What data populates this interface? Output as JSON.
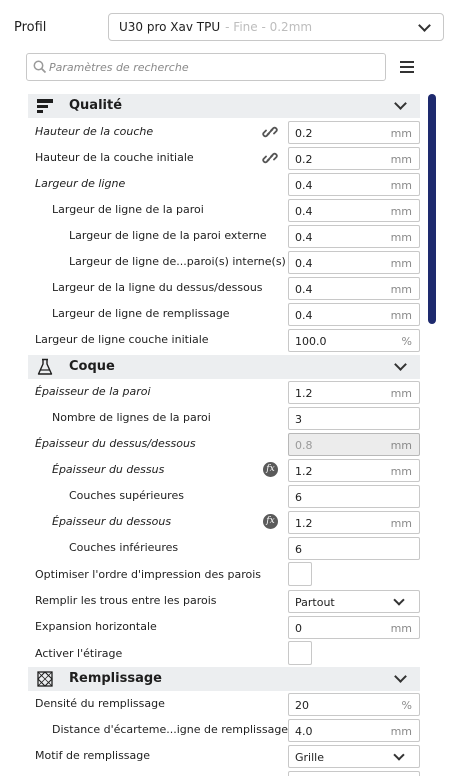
{
  "profile": {
    "label": "Profil",
    "selected": "U30 pro Xav TPU",
    "selected_sub": "- Fine - 0.2mm"
  },
  "search": {
    "placeholder": "Paramètres de recherche"
  },
  "icons": {
    "search": "search-icon",
    "menu": "hamburger-menu-icon",
    "link": "link-icon",
    "fx": "function-icon"
  },
  "colors": {
    "accent": "#1e2a6e",
    "category_bg": "#eceef0"
  },
  "categories": {
    "quality": {
      "title": "Qualité"
    },
    "shell": {
      "title": "Coque"
    },
    "infill": {
      "title": "Remplissage"
    }
  },
  "settings": {
    "layer_height": {
      "label": "Hauteur de la couche",
      "value": "0.2",
      "unit": "mm"
    },
    "initial_layer_height": {
      "label": "Hauteur de la couche initiale",
      "value": "0.2",
      "unit": "mm"
    },
    "line_width": {
      "label": "Largeur de ligne",
      "value": "0.4",
      "unit": "mm"
    },
    "wall_line_width": {
      "label": "Largeur de ligne de la paroi",
      "value": "0.4",
      "unit": "mm"
    },
    "outer_wall_line_width": {
      "label": "Largeur de ligne de la paroi externe",
      "value": "0.4",
      "unit": "mm"
    },
    "inner_wall_line_width": {
      "label": "Largeur de ligne de...paroi(s) interne(s)",
      "value": "0.4",
      "unit": "mm"
    },
    "top_bottom_line_width": {
      "label": "Largeur de la ligne du dessus/dessous",
      "value": "0.4",
      "unit": "mm"
    },
    "infill_line_width": {
      "label": "Largeur de ligne de remplissage",
      "value": "0.4",
      "unit": "mm"
    },
    "initial_layer_line_width": {
      "label": "Largeur de ligne couche initiale",
      "value": "100.0",
      "unit": "%"
    },
    "wall_thickness": {
      "label": "Épaisseur de la paroi",
      "value": "1.2",
      "unit": "mm"
    },
    "wall_line_count": {
      "label": "Nombre de lignes de la paroi",
      "value": "3"
    },
    "top_bottom_thickness": {
      "label": "Épaisseur du dessus/dessous",
      "value": "0.8",
      "unit": "mm"
    },
    "top_thickness": {
      "label": "Épaisseur du dessus",
      "value": "1.2",
      "unit": "mm"
    },
    "top_layers": {
      "label": "Couches supérieures",
      "value": "6"
    },
    "bottom_thickness": {
      "label": "Épaisseur du dessous",
      "value": "1.2",
      "unit": "mm"
    },
    "bottom_layers": {
      "label": "Couches inférieures",
      "value": "6"
    },
    "optimize_wall_order": {
      "label": "Optimiser l'ordre d'impression des parois",
      "checked": false
    },
    "fill_gaps": {
      "label": "Remplir les trous entre les parois",
      "value": "Partout"
    },
    "horizontal_expansion": {
      "label": "Expansion horizontale",
      "value": "0",
      "unit": "mm"
    },
    "enable_ironing": {
      "label": "Activer l'étirage",
      "checked": false
    },
    "infill_density": {
      "label": "Densité du remplissage",
      "value": "20",
      "unit": "%"
    },
    "infill_line_distance": {
      "label": "Distance d'écarteme...igne de remplissage",
      "value": "4.0",
      "unit": "mm"
    },
    "infill_pattern": {
      "label": "Motif de remplissage",
      "value": "Grille"
    }
  }
}
